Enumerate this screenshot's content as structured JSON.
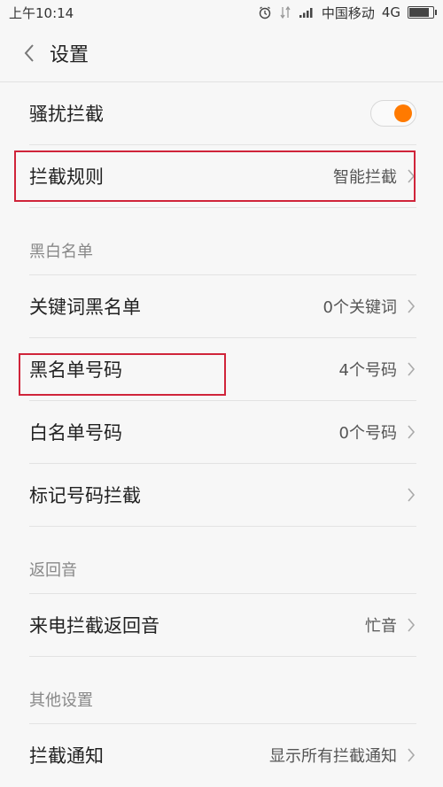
{
  "status_bar": {
    "time": "上午10:14",
    "carrier": "中国移动",
    "network": "4G",
    "battery_level": 0.85
  },
  "header": {
    "title": "设置"
  },
  "rows_top": [
    {
      "label": "骚扰拦截",
      "type": "toggle",
      "on": true
    },
    {
      "label": "拦截规则",
      "value": "智能拦截"
    }
  ],
  "sections": [
    {
      "title": "黑白名单",
      "items": [
        {
          "label": "关键词黑名单",
          "value": "0个关键词"
        },
        {
          "label": "黑名单号码",
          "value": "4个号码"
        },
        {
          "label": "白名单号码",
          "value": "0个号码"
        },
        {
          "label": "标记号码拦截",
          "value": ""
        }
      ]
    },
    {
      "title": "返回音",
      "items": [
        {
          "label": "来电拦截返回音",
          "value": "忙音"
        }
      ]
    },
    {
      "title": "其他设置",
      "items": [
        {
          "label": "拦截通知",
          "value": "显示所有拦截通知"
        }
      ]
    }
  ],
  "colors": {
    "accent": "#ff7a00",
    "annotation": "#d0243a"
  }
}
